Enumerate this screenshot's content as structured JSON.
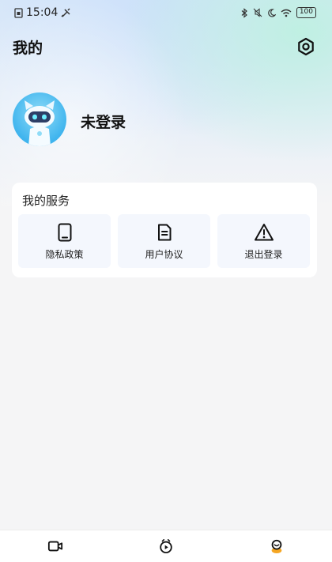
{
  "status_bar": {
    "time": "15:04",
    "battery": "100"
  },
  "header": {
    "title": "我的"
  },
  "profile": {
    "name": "未登录"
  },
  "services": {
    "title": "我的服务",
    "items": [
      {
        "label": "隐私政策",
        "icon": "phone-icon"
      },
      {
        "label": "用户协议",
        "icon": "document-icon"
      },
      {
        "label": "退出登录",
        "icon": "warning-icon"
      }
    ]
  },
  "tabbar": {
    "items": [
      {
        "icon": "video-icon",
        "label": ""
      },
      {
        "icon": "play-circle-icon",
        "label": ""
      },
      {
        "icon": "profile-icon",
        "label": "",
        "active": true
      }
    ]
  },
  "colors": {
    "accent": "#f5a623",
    "text": "#1d1d1f",
    "card_bg": "#ffffff",
    "tile_bg": "#f4f7fd"
  }
}
